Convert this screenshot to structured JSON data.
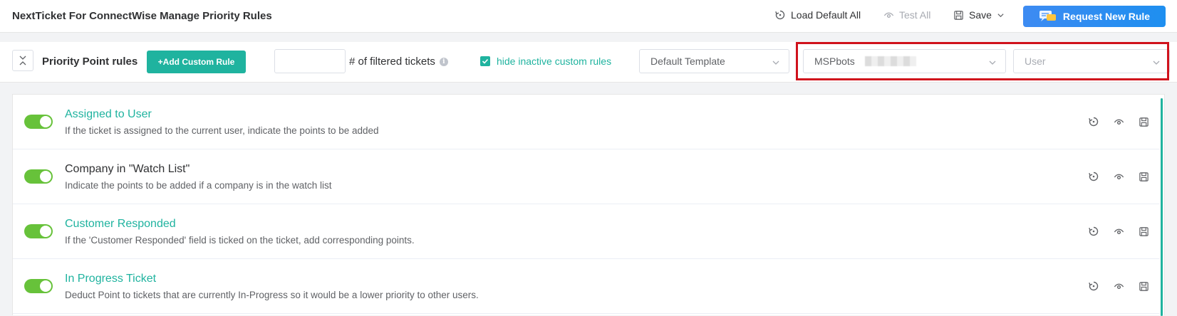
{
  "header": {
    "title": "NextTicket For ConnectWise Manage Priority Rules",
    "load_default_label": "Load Default All",
    "test_all_label": "Test All",
    "save_label": "Save",
    "request_label": "Request New Rule"
  },
  "toolbar": {
    "section_title": "Priority Point rules",
    "add_rule_label": "+Add Custom Rule",
    "filter_value": "",
    "filter_label": "# of filtered tickets",
    "hide_inactive_label": "hide inactive custom rules",
    "hide_inactive_checked": true,
    "template_select": "Default Template",
    "company_select": "MSPbots",
    "user_placeholder": "User"
  },
  "rules": [
    {
      "name": "Assigned to User",
      "description": "If the ticket is assigned to the current user, indicate the points to be added",
      "enabled": true
    },
    {
      "name": "Company in \"Watch List\"",
      "description": "Indicate the points to be added if a company is in the watch list",
      "enabled": true
    },
    {
      "name": "Customer Responded",
      "description": "If the 'Customer Responded' field is ticked on the ticket, add corresponding points.",
      "enabled": true
    },
    {
      "name": "In Progress Ticket",
      "description": "Deduct Point to tickets that are currently In-Progress so it would be a lower priority to other users.",
      "enabled": true
    }
  ],
  "colors": {
    "accent": "#1fb39f",
    "toggle_on": "#67c23a",
    "primary_button": "#1e8ff0",
    "highlight_box": "#d0121c"
  }
}
